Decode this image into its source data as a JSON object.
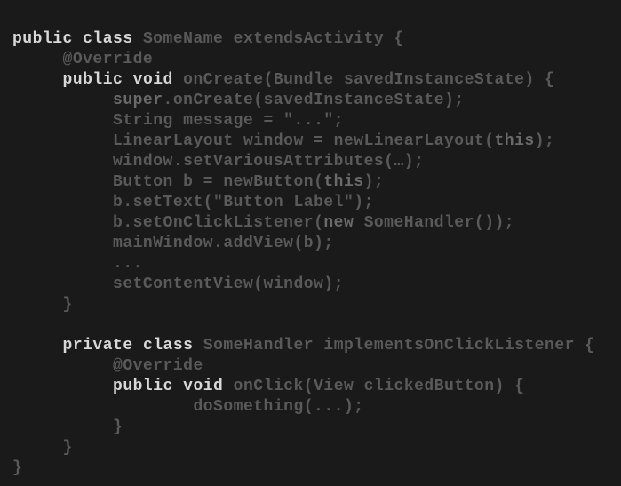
{
  "code": {
    "kw_public": "public",
    "kw_class": "class",
    "kw_void": "void",
    "kw_private": "private",
    "kw_this": "this",
    "kw_new": "new",
    "kw_super": "super",
    "line1_a": " SomeName extendsActivity {",
    "line2": "@Override",
    "line3_a": " onCreate(Bundle savedInstanceState) {",
    "line4_a": ".onCreate(savedInstanceState);",
    "line5": "String message = \"...\";",
    "line6_a": "LinearLayout window = newLinearLayout(",
    "line6_b": ");",
    "line7": "window.setVariousAttributes(…);",
    "line8_a": "Button b = newButton(",
    "line8_b": ");",
    "line9": "b.setText(\"Button Label\");",
    "line10_a": "b.setOnClickListener(",
    "line10_b": " SomeHandler());",
    "line11": "mainWindow.addView(b);",
    "line12": "...",
    "line13": "setContentView(window);",
    "line14": "}",
    "line16_a": " SomeHandler implementsOnClickListener {",
    "line17": "@Override",
    "line18_a": " onClick(View clickedButton) {",
    "line19": "doSomething(...);",
    "line20": "}",
    "line21": "}",
    "line22": "}",
    "indent1": "     ",
    "indent2": "          ",
    "indent3": "                  "
  }
}
